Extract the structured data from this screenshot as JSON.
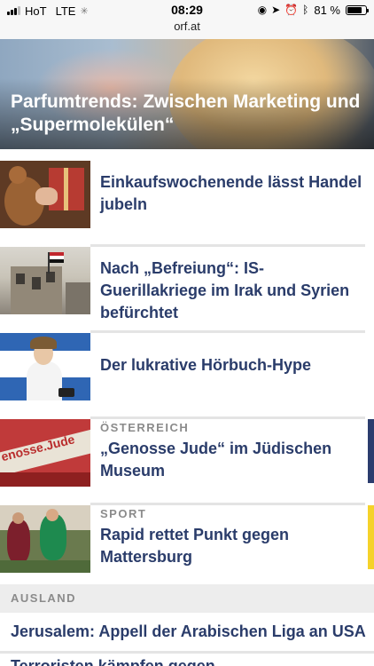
{
  "status_bar": {
    "carrier": "HoT",
    "network": "LTE",
    "time": "08:29",
    "url": "orf.at",
    "battery_percent": "81 %",
    "battery_level": 0.81
  },
  "hero": {
    "title": "Parfumtrends: Zwischen Marketing und „Supermolekülen“"
  },
  "articles": [
    {
      "category": "",
      "title": "Einkaufswochenende lässt Handel jubeln"
    },
    {
      "category": "",
      "title": "Nach „Befreiung“: IS-Guerillakriege im Irak und Syrien befürchtet"
    },
    {
      "category": "",
      "title": "Der lukrative Hörbuch-Hype"
    },
    {
      "category": "ÖSTERREICH",
      "title": "„Genosse Jude“ im Jüdischen Museum",
      "thumb_text": "enosse.Jude",
      "flag_color": "#2b3c6e"
    },
    {
      "category": "SPORT",
      "title": "Rapid rettet Punkt gegen Mattersburg",
      "flag_color": "#f5d22a"
    }
  ],
  "section": {
    "label": "AUSLAND",
    "items": [
      "Jerusalem: Appell der Arabischen Liga an USA",
      "Terroristen kämpfen gegen Kurzstreckenvertrag"
    ]
  },
  "colors": {
    "headline": "#2a3c6a",
    "category": "#8b8b8b",
    "separator": "#e4e4e4"
  }
}
